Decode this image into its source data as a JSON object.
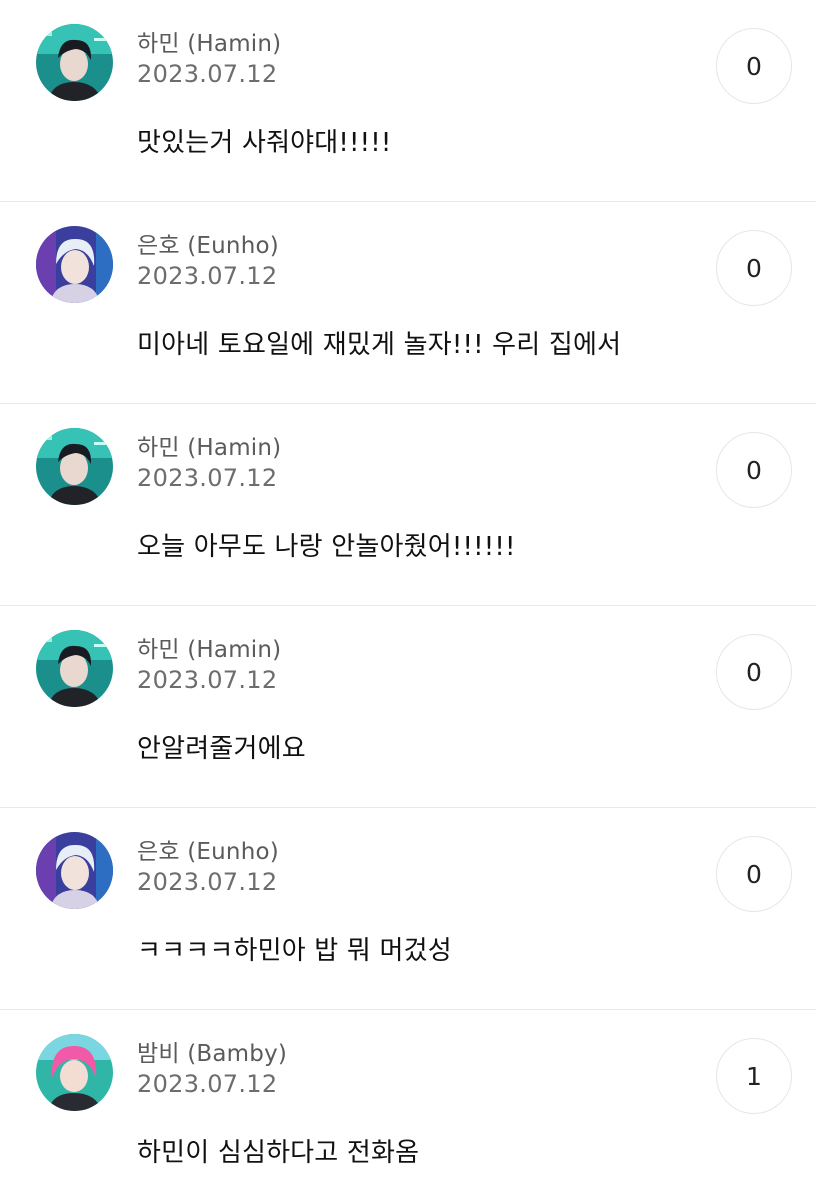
{
  "comments": [
    {
      "author": "하민 (Hamin)",
      "date": "2023.07.12",
      "text": "맛있는거 사줘야대!!!!!",
      "likes": "0",
      "avatar": "hamin-avatar"
    },
    {
      "author": "은호 (Eunho)",
      "date": "2023.07.12",
      "text": "미아네 토요일에 재밌게 놀자!!! 우리 집에서",
      "likes": "0",
      "avatar": "eunho-avatar"
    },
    {
      "author": "하민 (Hamin)",
      "date": "2023.07.12",
      "text": "오늘 아무도 나랑 안놀아줬어!!!!!!",
      "likes": "0",
      "avatar": "hamin-avatar"
    },
    {
      "author": "하민 (Hamin)",
      "date": "2023.07.12",
      "text": "안알려줄거에요",
      "likes": "0",
      "avatar": "hamin-avatar"
    },
    {
      "author": "은호 (Eunho)",
      "date": "2023.07.12",
      "text": "ㅋㅋㅋㅋ하민아 밥 뭐 머겄성",
      "likes": "0",
      "avatar": "eunho-avatar"
    },
    {
      "author": "밤비 (Bamby)",
      "date": "2023.07.12",
      "text": "하민이 심심하다고 전화옴",
      "likes": "1",
      "avatar": "bamby-avatar"
    }
  ],
  "colors": {
    "hamin_bg": "#1fa3a0",
    "eunho_bg": "#3a3f9e",
    "bamby_bg": "#e9549a"
  }
}
